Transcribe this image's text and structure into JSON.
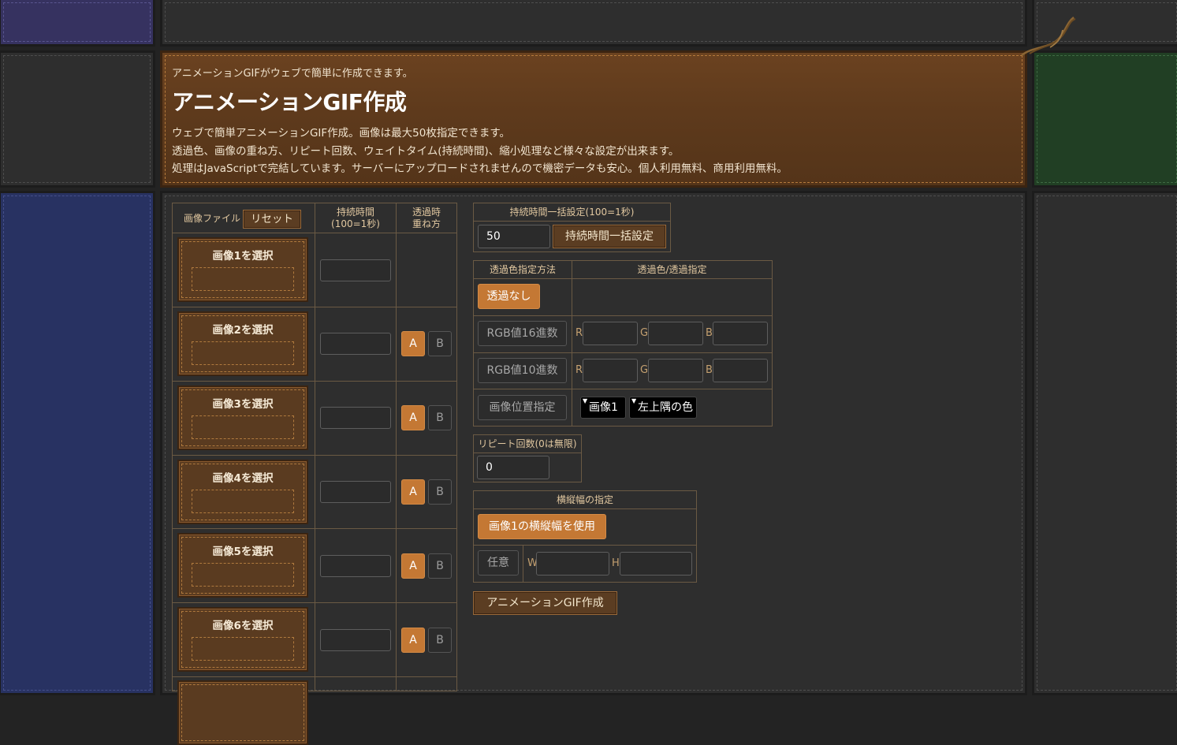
{
  "header": {
    "subtitle": "アニメーションGIFがウェブで簡単に作成できます。",
    "title": "アニメーションGIF作成",
    "description": [
      "ウェブで簡単アニメーションGIF作成。画像は最大50枚指定できます。",
      "透過色、画像の重ね方、リピート回数、ウェイトタイム(持続時間)、縮小処理など様々な設定が出来ます。",
      "処理はJavaScriptで完結しています。サーバーにアップロードされませんので機密データも安心。個人利用無料、商用利用無料。"
    ]
  },
  "images_table": {
    "col_file": "画像ファイル",
    "reset_label": "リセット",
    "col_duration": [
      "持続時間",
      "(100=1秒)"
    ],
    "col_blend": [
      "透過時",
      "重ね方"
    ],
    "rows": [
      {
        "label": "画像1を選択",
        "duration": "",
        "ab": false
      },
      {
        "label": "画像2を選択",
        "duration": "",
        "ab": true
      },
      {
        "label": "画像3を選択",
        "duration": "",
        "ab": true
      },
      {
        "label": "画像4を選択",
        "duration": "",
        "ab": true
      },
      {
        "label": "画像5を選択",
        "duration": "",
        "ab": true
      },
      {
        "label": "画像6を選択",
        "duration": "",
        "ab": true
      }
    ],
    "a_label": "A",
    "b_label": "B"
  },
  "bulk_duration": {
    "header": "持続時間一括設定(100=1秒)",
    "value": "50",
    "button": "持続時間一括設定"
  },
  "transparency": {
    "col_method": "透過色指定方法",
    "col_color": "透過色/透過指定",
    "none": "透過なし",
    "hex": "RGB値16進数",
    "dec": "RGB値10進数",
    "pos": "画像位置指定",
    "r": "R",
    "g": "G",
    "b": "B",
    "pos_image": "画像1",
    "pos_corner": "左上隅の色"
  },
  "repeat": {
    "header": "リピート回数(0は無限)",
    "value": "0"
  },
  "size": {
    "header": "横縦幅の指定",
    "use_image1": "画像1の横縦幅を使用",
    "custom": "任意",
    "w": "W",
    "h": "H"
  },
  "create_button": "アニメーションGIF作成",
  "colors": {
    "accent": "#c47834",
    "header_bg": "#5e3a1c",
    "left_panel": "#283262",
    "right_panel": "#213f24"
  }
}
